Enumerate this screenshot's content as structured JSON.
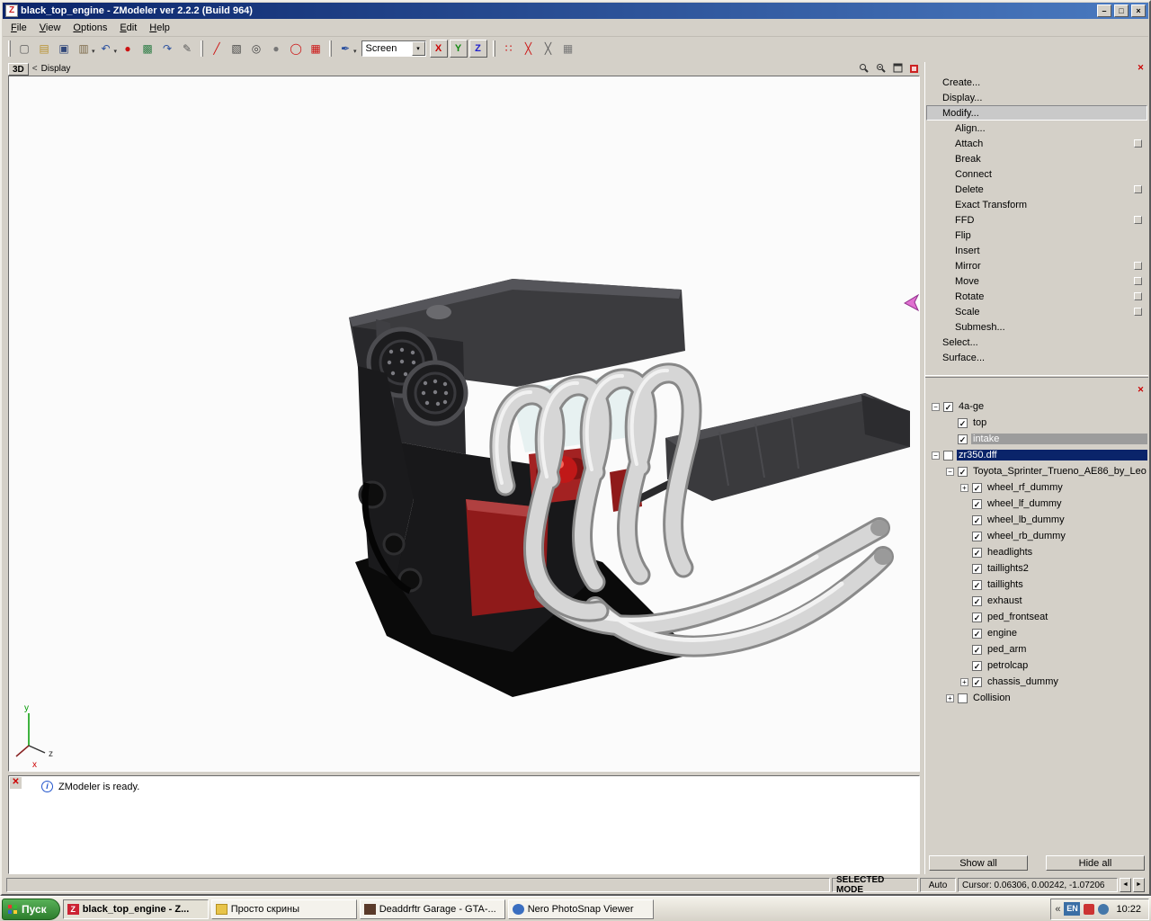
{
  "colors": {
    "titlebar_start": "#0a246a",
    "titlebar_end": "#4a7ac0",
    "chrome_gray": "#d4d0c8",
    "selection_blue": "#0a246a",
    "selection_gray": "#9c9c9c",
    "viewport_bg": "#fbfbfb",
    "accent_red": "#cc0000"
  },
  "window": {
    "title": "black_top_engine - ZModeler ver 2.2.2 (Build 964)",
    "icon_glyph": "Z",
    "minimize": "–",
    "restore": "□",
    "close": "×"
  },
  "menu": {
    "items": [
      {
        "label": "File"
      },
      {
        "label": "View"
      },
      {
        "label": "Options"
      },
      {
        "label": "Edit"
      },
      {
        "label": "Help"
      }
    ]
  },
  "toolbar": {
    "dd": "▾",
    "view_mode": "Screen",
    "icons": [
      {
        "name": "new",
        "glyph": "▢"
      },
      {
        "name": "open",
        "glyph": "▤"
      },
      {
        "name": "save",
        "glyph": "▣"
      },
      {
        "name": "paste",
        "glyph": "▥"
      },
      {
        "name": "undo",
        "glyph": "↶"
      },
      {
        "name": "record",
        "glyph": "●"
      },
      {
        "name": "export",
        "glyph": "▩"
      },
      {
        "name": "redo",
        "glyph": "↷"
      },
      {
        "name": "notes",
        "glyph": "✎"
      },
      {
        "name": "spline",
        "glyph": "╱"
      },
      {
        "name": "box",
        "glyph": "▧"
      },
      {
        "name": "cylinder",
        "glyph": "◎"
      },
      {
        "name": "sphere",
        "glyph": "●"
      },
      {
        "name": "torus",
        "glyph": "◯"
      },
      {
        "name": "grid",
        "glyph": "▦"
      },
      {
        "name": "pen",
        "glyph": "✒"
      }
    ],
    "axis": [
      {
        "label": "X"
      },
      {
        "label": "Y"
      },
      {
        "label": "Z"
      }
    ],
    "right_icons": [
      {
        "name": "vertices",
        "glyph": "∷"
      },
      {
        "name": "axes-red",
        "glyph": "╳"
      },
      {
        "name": "axes-gray",
        "glyph": "╳"
      },
      {
        "name": "uv-grid",
        "glyph": "▦"
      }
    ]
  },
  "viewport": {
    "tab": "3D",
    "back": "<",
    "label": "Display"
  },
  "command_panel": {
    "items": [
      {
        "label": "Create...",
        "level": 0
      },
      {
        "label": "Display...",
        "level": 0
      },
      {
        "label": "Modify...",
        "level": 0,
        "selected": true
      },
      {
        "label": "Align...",
        "level": 1
      },
      {
        "label": "Attach",
        "level": 1,
        "has_box": true
      },
      {
        "label": "Break",
        "level": 1
      },
      {
        "label": "Connect",
        "level": 1
      },
      {
        "label": "Delete",
        "level": 1,
        "has_box": true
      },
      {
        "label": "Exact Transform",
        "level": 1
      },
      {
        "label": "FFD",
        "level": 1,
        "has_box": true
      },
      {
        "label": "Flip",
        "level": 1
      },
      {
        "label": "Insert",
        "level": 1
      },
      {
        "label": "Mirror",
        "level": 1,
        "has_box": true
      },
      {
        "label": "Move",
        "level": 1,
        "has_box": true
      },
      {
        "label": "Rotate",
        "level": 1,
        "has_box": true
      },
      {
        "label": "Scale",
        "level": 1,
        "has_box": true
      },
      {
        "label": "Submesh...",
        "level": 1
      },
      {
        "label": "Select...",
        "level": 0
      },
      {
        "label": "Surface...",
        "level": 0
      }
    ]
  },
  "scene_tree": {
    "items": [
      {
        "label": "4a-ge",
        "level": 0,
        "expander": "-",
        "checked": true
      },
      {
        "label": "top",
        "level": 1,
        "checked": true
      },
      {
        "label": "intake",
        "level": 1,
        "checked": true,
        "selected": "gray"
      },
      {
        "label": "zr350.dff",
        "level": 0,
        "expander": "-",
        "checked": false,
        "selected": "blue"
      },
      {
        "label": "Toyota_Sprinter_Trueno_AE86_by_Leo",
        "level": 1,
        "expander": "-",
        "checked": true
      },
      {
        "label": "wheel_rf_dummy",
        "level": 2,
        "expander": "+",
        "checked": true
      },
      {
        "label": "wheel_lf_dummy",
        "level": 2,
        "checked": true
      },
      {
        "label": "wheel_lb_dummy",
        "level": 2,
        "checked": true
      },
      {
        "label": "wheel_rb_dummy",
        "level": 2,
        "checked": true
      },
      {
        "label": "headlights",
        "level": 2,
        "checked": true
      },
      {
        "label": "taillights2",
        "level": 2,
        "checked": true
      },
      {
        "label": "taillights",
        "level": 2,
        "checked": true
      },
      {
        "label": "exhaust",
        "level": 2,
        "checked": true
      },
      {
        "label": "ped_frontseat",
        "level": 2,
        "checked": true
      },
      {
        "label": "engine",
        "level": 2,
        "checked": true
      },
      {
        "label": "ped_arm",
        "level": 2,
        "checked": true
      },
      {
        "label": "petrolcap",
        "level": 2,
        "checked": true
      },
      {
        "label": "chassis_dummy",
        "level": 2,
        "expander": "+",
        "checked": true
      },
      {
        "label": "Collision",
        "level": 1,
        "expander": "+",
        "checked": false
      }
    ],
    "buttons": {
      "show_all": "Show all",
      "hide_all": "Hide all"
    }
  },
  "glyphs": {
    "check": "✓",
    "plus": "+",
    "minus": "−",
    "close_x": "✕"
  },
  "log": {
    "info_glyph": "i",
    "message": "ZModeler is ready."
  },
  "status": {
    "mode": "SELECTED MODE",
    "auto": "Auto",
    "cursor": "Cursor: 0.06306, 0.00242, -1.07206",
    "scroll_left": "◄",
    "scroll_right": "►"
  },
  "taskbar": {
    "start": "Пуск",
    "tasks": [
      {
        "label": "black_top_engine - Z...",
        "icon": "zmodeler"
      },
      {
        "label": "Просто скрины",
        "icon": "folder"
      },
      {
        "label": "Deaddrftr Garage - GTA-...",
        "icon": "gta"
      },
      {
        "label": "Nero PhotoSnap Viewer",
        "icon": "nero"
      }
    ],
    "tray": {
      "chevron": "«",
      "lang": "EN",
      "time": "10:22"
    }
  }
}
